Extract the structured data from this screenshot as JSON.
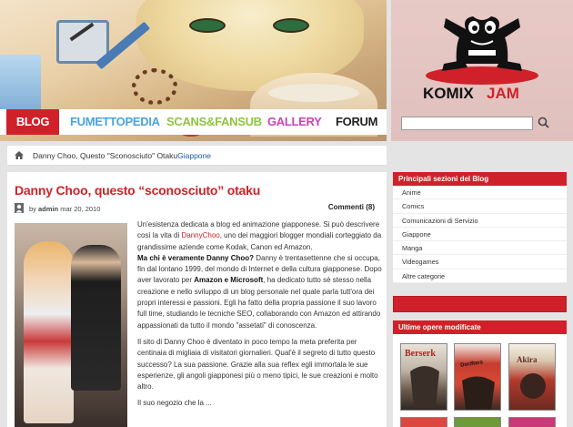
{
  "colors": {
    "accent": "#d0212a",
    "link": "#1a58a6"
  },
  "nav": {
    "items": [
      {
        "label": "BLOG",
        "color": "#ffffff",
        "active": true
      },
      {
        "label": "FUMETTOPEDIA",
        "color": "#4aa3df"
      },
      {
        "label": "SCANS&FANSUB",
        "color": "#8fc43f"
      },
      {
        "label": "GALLERY",
        "color": "#c944b5"
      },
      {
        "label": "FORUM",
        "color": "#222222"
      }
    ]
  },
  "logo": {
    "text_left": "KOMIX",
    "text_right": "JAM"
  },
  "search": {
    "placeholder": "",
    "icon": "search-icon"
  },
  "breadcrumb": {
    "current": "Danny Choo, Questo \"Sconosciuto\" Otaku",
    "category": "Giappone"
  },
  "post": {
    "title": "Danny Choo, questo “sconosciuto” otaku",
    "by": "by",
    "author": "admin",
    "date": "mar 20, 2010",
    "comments": "Commenti (8)",
    "p1_a": "Un'esistenza dedicata a blog ed animazione giapponese. Si può descrivere così la vita  di ",
    "p1_link": "DannyChoo",
    "p1_b": ", uno dei maggiori blogger mondiali corteggiato da grandissime aziende come Kodak, Canon ed Amazon.",
    "p2_q": "Ma chi è veramente Danny Choo?",
    "p2_a": " Danny è trentasettenne che si occupa, fin dal lontano 1999, del mondo di Internet e della cultura giapponese. Dopo aver lavorato per ",
    "p2_b": "Amazon e Microsoft",
    "p2_c": ", ha dedicato tutto sè stesso nella creazione e nello sviluppo di un blog personale nel quale parla tutt'ora dei propri interessi e passioni. Egli ha fatto della propria passione il suo lavoro full time, studiando le tecniche SEO, collaborando con Amazon ed attirando appassionati da tutto il mondo \"assetati\" di conoscenza.",
    "p3": "Il sito di Danny Choo è diventato in poco tempo la meta preferita per centinaia di migliaia di visitatori giornalieri. Qual'è il segreto di tutto questo successo? La sua passione. Grazie alla sua reflex egli immortala le sue esperienze, gli angoli giapponesi più o meno tipici, le sue creazioni e molto altro.",
    "p4": "Il suo negozio che la ..."
  },
  "sidebar": {
    "categories_title": "Principali sezioni del Blog",
    "categories": [
      "Anime",
      "Comics",
      "Comunicazioni di Servizio",
      "Giappone",
      "Manga",
      "Videogames",
      "Altre categorie"
    ],
    "latest_title": "Ultime opere modificate",
    "latest": [
      {
        "title": "Berserk",
        "color": "#c9c2b8"
      },
      {
        "title": "Dorifters",
        "color": "#c52a22"
      },
      {
        "title": "Akira",
        "color": "#b9322b"
      }
    ]
  }
}
